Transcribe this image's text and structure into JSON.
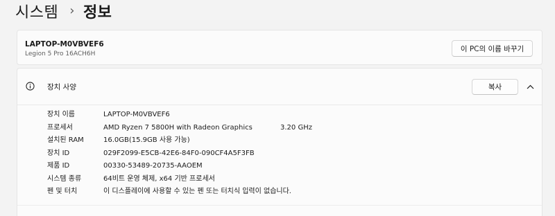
{
  "breadcrumb": {
    "parent": "시스템",
    "separator": "›",
    "current": "정보"
  },
  "device": {
    "name": "LAPTOP-M0VBVEF6",
    "model": "Legion 5 Pro 16ACH6H",
    "rename_label": "이 PC의 이름 바꾸기"
  },
  "specs": {
    "icon": "info-icon",
    "title": "장치 사양",
    "copy_label": "복사",
    "collapse_icon": "chevron-up-icon",
    "rows": [
      {
        "label": "장치 이름",
        "value": "LAPTOP-M0VBVEF6",
        "extra": ""
      },
      {
        "label": "프로세서",
        "value": "AMD Ryzen 7 5800H with Radeon Graphics",
        "extra": "3.20 GHz"
      },
      {
        "label": "설치된 RAM",
        "value": "16.0GB(15.9GB 사용 가능)",
        "extra": ""
      },
      {
        "label": "장치 ID",
        "value": "029F2099-E5CB-42E6-84F0-090CF4A5F3FB",
        "extra": ""
      },
      {
        "label": "제품 ID",
        "value": "00330-53489-20735-AAOEM",
        "extra": ""
      },
      {
        "label": "시스템 종류",
        "value": "64비트 운영 체제, x64 기반 프로세서",
        "extra": ""
      },
      {
        "label": "펜 및 터치",
        "value": "이 디스플레이에 사용할 수 있는 펜 또는 터치식 입력이 없습니다.",
        "extra": ""
      }
    ]
  },
  "colors": {
    "page_bg": "#f3f3f3",
    "card_bg": "#fbfbfb",
    "border": "#e5e5e5",
    "text": "#1b1b1b"
  }
}
